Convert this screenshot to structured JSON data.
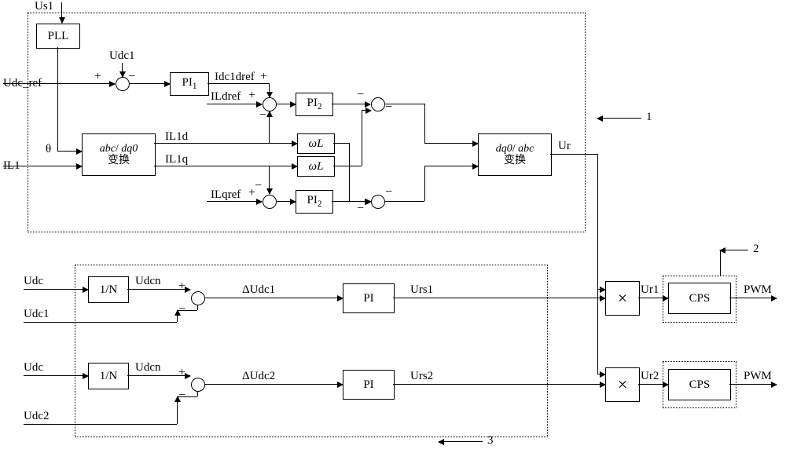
{
  "inputs": {
    "us1": "Us1",
    "udc_ref": "Udc_ref",
    "il1": "IL1",
    "udc_a": "Udc",
    "udc1_a": "Udc1",
    "udc_b": "Udc",
    "udc2_b": "Udc2",
    "theta": "θ",
    "udc1_top": "Udc1"
  },
  "blocks": {
    "pll": "PLL",
    "pi1": "PI₁",
    "pi2_top": "PI₂",
    "pi2_bot": "PI₂",
    "wl_top": "ωL",
    "wl_bot": "ωL",
    "abc_dq0": "abc/ dq0\n变换",
    "dq0_abc": "dq0/ abc\n变换",
    "one_over_n_a": "1/N",
    "one_over_n_b": "1/N",
    "pi_a": "PI",
    "pi_b": "PI",
    "cps_a": "CPS",
    "cps_b": "CPS"
  },
  "signals": {
    "idc1dref": "Idc1dref",
    "ildref": "ILdref",
    "il1d": "IL1d",
    "il1q": "IL1q",
    "ilqref": "ILqref",
    "ur": "Ur",
    "udcn_a": "Udcn",
    "udcn_b": "Udcn",
    "dudc1": "ΔUdc1",
    "dudc2": "ΔUdc2",
    "urs1": "Urs1",
    "urs2": "Urs2",
    "ur1": "Ur1",
    "ur2": "Ur2"
  },
  "outputs": {
    "pwm_a": "PWM",
    "pwm_b": "PWM"
  },
  "annotations": {
    "num1": "1",
    "num2": "2",
    "num3": "3"
  },
  "symbols": {
    "mult": "×"
  }
}
